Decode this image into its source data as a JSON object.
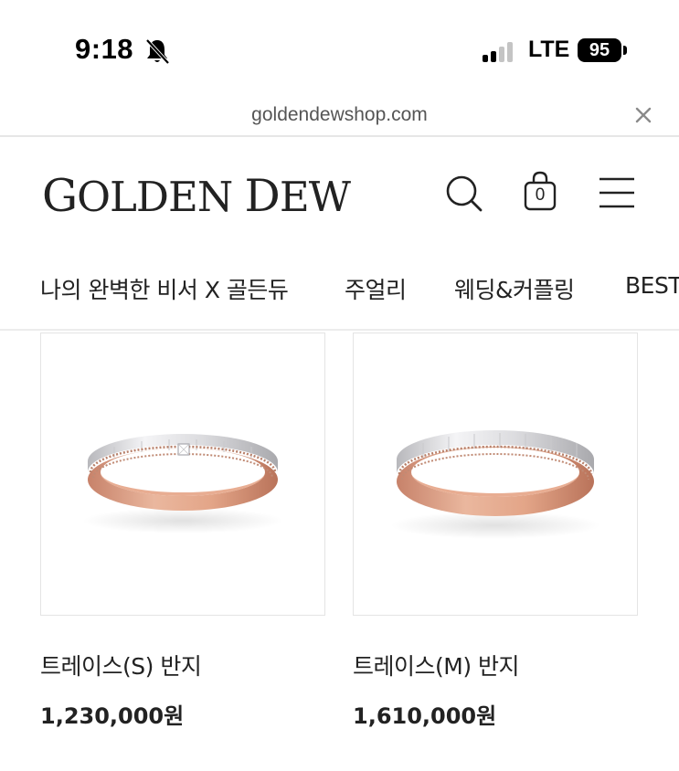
{
  "status_bar": {
    "time": "9:18",
    "network": "LTE",
    "battery": "95",
    "icons": {
      "bell": "bell-slash-icon",
      "signal": "cellular-signal-icon",
      "battery": "battery-icon"
    }
  },
  "browser": {
    "url": "goldendewshop.com",
    "close_icon": "close-icon"
  },
  "header": {
    "logo_first": "G",
    "logo_rest": "OLDEN ",
    "logo_d": "D",
    "logo_ew": "EW",
    "icons": {
      "search": "search-icon",
      "bag": "shopping-bag-icon",
      "menu": "hamburger-menu-icon"
    },
    "bag_count": "0"
  },
  "nav": {
    "items": [
      {
        "label": "나의 완벽한 비서 X 골든듀"
      },
      {
        "label": "주얼리"
      },
      {
        "label": "웨딩&커플링"
      },
      {
        "label": "BEST"
      }
    ]
  },
  "products": [
    {
      "name": "트레이스(S) 반지",
      "price": "1,230,000원",
      "has_diamond": true
    },
    {
      "name": "트레이스(M) 반지",
      "price": "1,610,000원",
      "has_diamond": false
    }
  ],
  "colors": {
    "rose_gold": "#d99a7e",
    "rose_gold_dark": "#b9735a",
    "white_gold": "#e8e8ea",
    "border": "#e4e4e4",
    "text": "#222222"
  }
}
